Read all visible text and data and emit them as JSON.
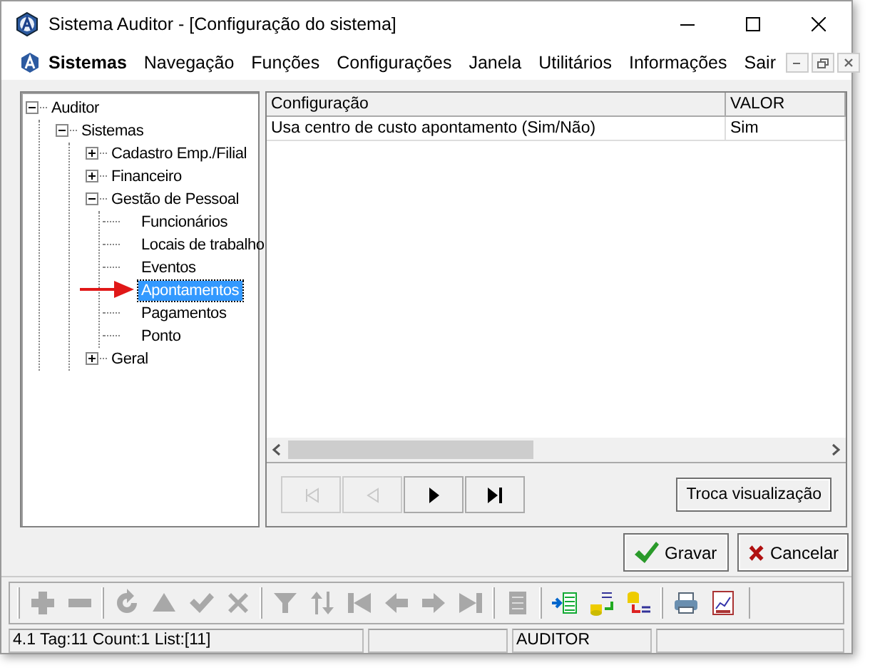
{
  "window": {
    "title": "Sistema Auditor - [Configuração do sistema]"
  },
  "menu": [
    {
      "label": "Sistemas",
      "selected": true
    },
    {
      "label": "Navegação",
      "selected": false
    },
    {
      "label": "Funções",
      "selected": false
    },
    {
      "label": "Configurações",
      "selected": false
    },
    {
      "label": "Janela",
      "selected": false
    },
    {
      "label": "Utilitários",
      "selected": false
    },
    {
      "label": "Informações",
      "selected": false
    },
    {
      "label": "Sair",
      "selected": false
    }
  ],
  "tree": [
    {
      "label": "Auditor",
      "expanded": true,
      "selected": false,
      "children": [
        {
          "label": "Sistemas",
          "expanded": true,
          "selected": false,
          "children": [
            {
              "label": "Cadastro Emp./Filial",
              "expanded": false,
              "selected": false
            },
            {
              "label": "Financeiro",
              "expanded": false,
              "selected": false
            },
            {
              "label": "Gestão de Pessoal",
              "expanded": true,
              "selected": false,
              "children": [
                {
                  "label": "Funcionários",
                  "selected": false
                },
                {
                  "label": "Locais de trabalho",
                  "selected": false
                },
                {
                  "label": "Eventos",
                  "selected": false
                },
                {
                  "label": "Apontamentos",
                  "selected": true
                },
                {
                  "label": "Pagamentos",
                  "selected": false
                },
                {
                  "label": "Ponto",
                  "selected": false
                }
              ]
            },
            {
              "label": "Geral",
              "expanded": false,
              "selected": false
            }
          ]
        }
      ]
    }
  ],
  "table": {
    "columns": [
      "Configuração",
      "VALOR"
    ],
    "rows": [
      [
        "Usa centro de custo apontamento (Sim/Não)",
        "Sim"
      ]
    ]
  },
  "navigation": [
    {
      "kind": "first",
      "disabled": true
    },
    {
      "kind": "prev",
      "disabled": true
    },
    {
      "kind": "next",
      "disabled": false
    },
    {
      "kind": "last",
      "disabled": false
    }
  ],
  "view_button": "Troca visualização",
  "actions": [
    {
      "kind": "save",
      "label": "Gravar"
    },
    {
      "kind": "cancel",
      "label": "Cancelar"
    }
  ],
  "toolbar": [
    [
      {
        "kind": "plus",
        "disabled": true
      },
      {
        "kind": "minus",
        "disabled": true
      }
    ],
    [
      {
        "kind": "refresh",
        "disabled": true
      },
      {
        "kind": "up",
        "disabled": true
      },
      {
        "kind": "check",
        "disabled": true
      },
      {
        "kind": "cross",
        "disabled": true
      }
    ],
    [
      {
        "kind": "filter",
        "disabled": true
      },
      {
        "kind": "sort",
        "disabled": true
      },
      {
        "kind": "first",
        "disabled": true
      },
      {
        "kind": "prev",
        "disabled": true
      },
      {
        "kind": "next",
        "disabled": true
      },
      {
        "kind": "last",
        "disabled": true
      }
    ],
    [
      {
        "kind": "document",
        "disabled": true
      }
    ],
    [
      {
        "kind": "import",
        "disabled": false
      },
      {
        "kind": "transfer",
        "disabled": false
      },
      {
        "kind": "query",
        "disabled": false
      }
    ],
    [
      {
        "kind": "print",
        "disabled": false
      },
      {
        "kind": "chart",
        "disabled": false
      }
    ]
  ],
  "status_bar": [
    "4.1 Tag:11 Count:1 List:[11]",
    "AUDITOR"
  ]
}
